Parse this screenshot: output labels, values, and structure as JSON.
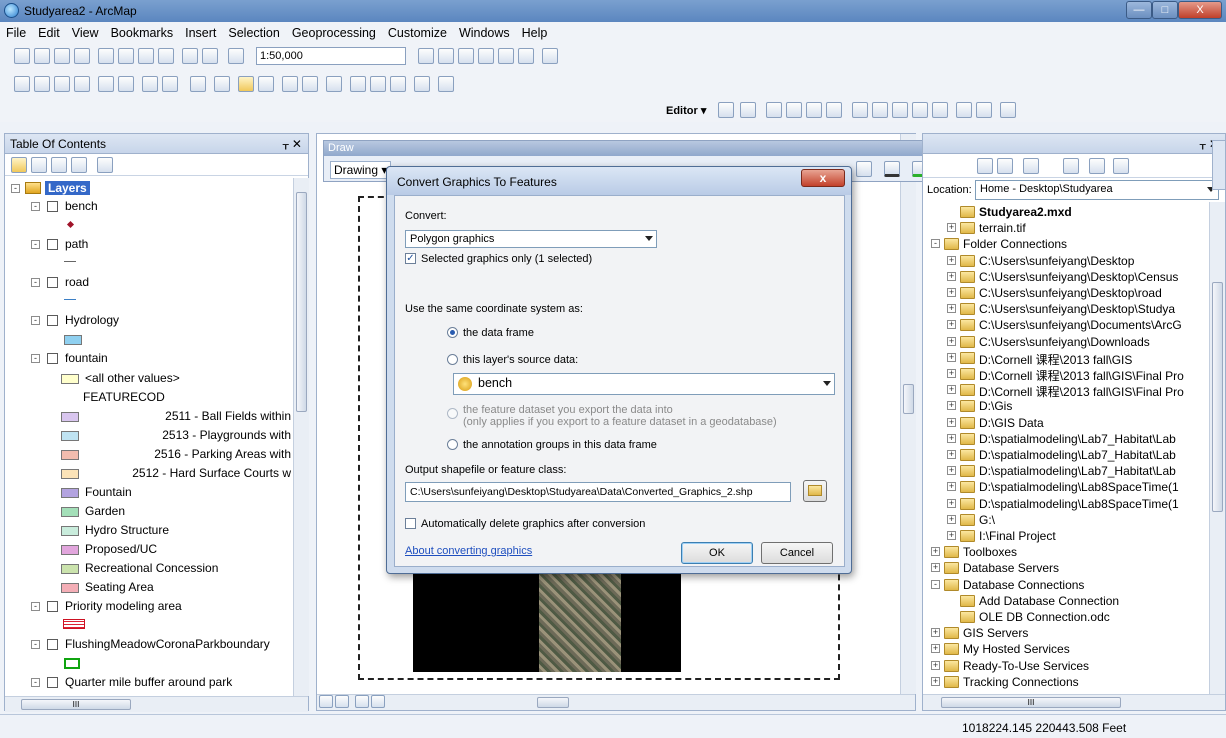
{
  "window": {
    "title": "Studyarea2 - ArcMap",
    "minimize": "—",
    "maximize": "□",
    "close": "X"
  },
  "menu": [
    "File",
    "Edit",
    "View",
    "Bookmarks",
    "Insert",
    "Selection",
    "Geoprocessing",
    "Customize",
    "Windows",
    "Help"
  ],
  "toolbar": {
    "scale": "1:50,000",
    "editor_label": "Editor ▾"
  },
  "toc": {
    "title": "Table Of Contents",
    "pin": "ᚁ ✕",
    "root": "Layers",
    "layers": [
      {
        "name": "bench"
      },
      {
        "name": "path"
      },
      {
        "name": "road"
      },
      {
        "name": "Hydrology"
      },
      {
        "name": "fountain"
      }
    ],
    "fountain_items": [
      {
        "label": "<all other values>",
        "color": "#ffffcc"
      },
      {
        "label": "FEATURECOD",
        "color": ""
      },
      {
        "label": "2511 - Ball Fields within",
        "color": "#d9c6ef"
      },
      {
        "label": "2513 - Playgrounds with",
        "color": "#bfe3f2"
      },
      {
        "label": "2516 - Parking Areas with",
        "color": "#f1bcae"
      },
      {
        "label": "2512 - Hard Surface Courts w",
        "color": "#fbe3b8"
      },
      {
        "label": "Fountain",
        "color": "#b3a3e0"
      },
      {
        "label": "Garden",
        "color": "#a3dfb8"
      },
      {
        "label": "Hydro Structure",
        "color": "#c9ecdc"
      },
      {
        "label": "Proposed/UC",
        "color": "#e2a6dd"
      },
      {
        "label": "Recreational Concession",
        "color": "#cbe3ad"
      },
      {
        "label": "Seating Area",
        "color": "#f4aeb6"
      }
    ],
    "more_layers": [
      {
        "name": "Priority modeling area"
      },
      {
        "name": "FlushingMeadowCoronaParkboundary"
      },
      {
        "name": "Quarter mile buffer around park"
      }
    ],
    "hscroll_label": "III"
  },
  "draw_toolbar": {
    "title": "Draw",
    "drawing_label": "Drawing ▾"
  },
  "dialog": {
    "title": "Convert Graphics To Features",
    "close": "x",
    "convert_label": "Convert:",
    "convert_value": "Polygon graphics",
    "selected_only": "Selected graphics only  (1 selected)",
    "coord_label": "Use the same coordinate system as:",
    "opt_data_frame": "the data frame",
    "opt_layer_source": "this layer's source data:",
    "layer_value": "bench",
    "opt_feature_dataset": "the feature dataset you export the data into",
    "opt_feature_dataset_note": "(only applies if you export to a feature dataset in a geodatabase)",
    "opt_annotation": "the annotation groups in this data frame",
    "output_label": "Output shapefile or feature class:",
    "output_value": "C:\\Users\\sunfeiyang\\Desktop\\Studyarea\\Data\\Converted_Graphics_2.shp",
    "auto_delete": "Automatically delete graphics after conversion",
    "about_link": "About converting graphics",
    "ok": "OK",
    "cancel": "Cancel"
  },
  "catalog": {
    "pin": "ᚁ ✕",
    "location_label": "Location:",
    "location_value": "Home - Desktop\\Studyarea",
    "items": [
      {
        "label": "Studyarea2.mxd",
        "bold": true,
        "indent": 1,
        "exp": ""
      },
      {
        "label": "terrain.tif",
        "bold": false,
        "indent": 1,
        "exp": "+"
      },
      {
        "label": "Folder Connections",
        "bold": false,
        "indent": 0,
        "exp": "-"
      },
      {
        "label": "C:\\Users\\sunfeiyang\\Desktop",
        "bold": false,
        "indent": 1,
        "exp": "+"
      },
      {
        "label": "C:\\Users\\sunfeiyang\\Desktop\\Census",
        "bold": false,
        "indent": 1,
        "exp": "+"
      },
      {
        "label": "C:\\Users\\sunfeiyang\\Desktop\\road",
        "bold": false,
        "indent": 1,
        "exp": "+"
      },
      {
        "label": "C:\\Users\\sunfeiyang\\Desktop\\Studya",
        "bold": false,
        "indent": 1,
        "exp": "+"
      },
      {
        "label": "C:\\Users\\sunfeiyang\\Documents\\ArcG",
        "bold": false,
        "indent": 1,
        "exp": "+"
      },
      {
        "label": "C:\\Users\\sunfeiyang\\Downloads",
        "bold": false,
        "indent": 1,
        "exp": "+"
      },
      {
        "label": "D:\\Cornell 课程\\2013 fall\\GIS",
        "bold": false,
        "indent": 1,
        "exp": "+"
      },
      {
        "label": "D:\\Cornell 课程\\2013 fall\\GIS\\Final Pro",
        "bold": false,
        "indent": 1,
        "exp": "+"
      },
      {
        "label": "D:\\Cornell 课程\\2013 fall\\GIS\\Final Pro",
        "bold": false,
        "indent": 1,
        "exp": "+"
      },
      {
        "label": "D:\\Gis",
        "bold": false,
        "indent": 1,
        "exp": "+"
      },
      {
        "label": "D:\\GIS Data",
        "bold": false,
        "indent": 1,
        "exp": "+"
      },
      {
        "label": "D:\\spatialmodeling\\Lab7_Habitat\\Lab",
        "bold": false,
        "indent": 1,
        "exp": "+"
      },
      {
        "label": "D:\\spatialmodeling\\Lab7_Habitat\\Lab",
        "bold": false,
        "indent": 1,
        "exp": "+"
      },
      {
        "label": "D:\\spatialmodeling\\Lab7_Habitat\\Lab",
        "bold": false,
        "indent": 1,
        "exp": "+"
      },
      {
        "label": "D:\\spatialmodeling\\Lab8SpaceTime(1",
        "bold": false,
        "indent": 1,
        "exp": "+"
      },
      {
        "label": "D:\\spatialmodeling\\Lab8SpaceTime(1",
        "bold": false,
        "indent": 1,
        "exp": "+"
      },
      {
        "label": "G:\\",
        "bold": false,
        "indent": 1,
        "exp": "+"
      },
      {
        "label": "I:\\Final Project",
        "bold": false,
        "indent": 1,
        "exp": "+"
      },
      {
        "label": "Toolboxes",
        "bold": false,
        "indent": 0,
        "exp": "+"
      },
      {
        "label": "Database Servers",
        "bold": false,
        "indent": 0,
        "exp": "+"
      },
      {
        "label": "Database Connections",
        "bold": false,
        "indent": 0,
        "exp": "-"
      },
      {
        "label": "Add Database Connection",
        "bold": false,
        "indent": 1,
        "exp": ""
      },
      {
        "label": "OLE DB Connection.odc",
        "bold": false,
        "indent": 1,
        "exp": ""
      },
      {
        "label": "GIS Servers",
        "bold": false,
        "indent": 0,
        "exp": "+"
      },
      {
        "label": "My Hosted Services",
        "bold": false,
        "indent": 0,
        "exp": "+"
      },
      {
        "label": "Ready-To-Use Services",
        "bold": false,
        "indent": 0,
        "exp": "+"
      },
      {
        "label": "Tracking Connections",
        "bold": false,
        "indent": 0,
        "exp": "+"
      }
    ],
    "hscroll_label": "III"
  },
  "status": {
    "coords": "1018224.145  220443.508 Feet"
  }
}
